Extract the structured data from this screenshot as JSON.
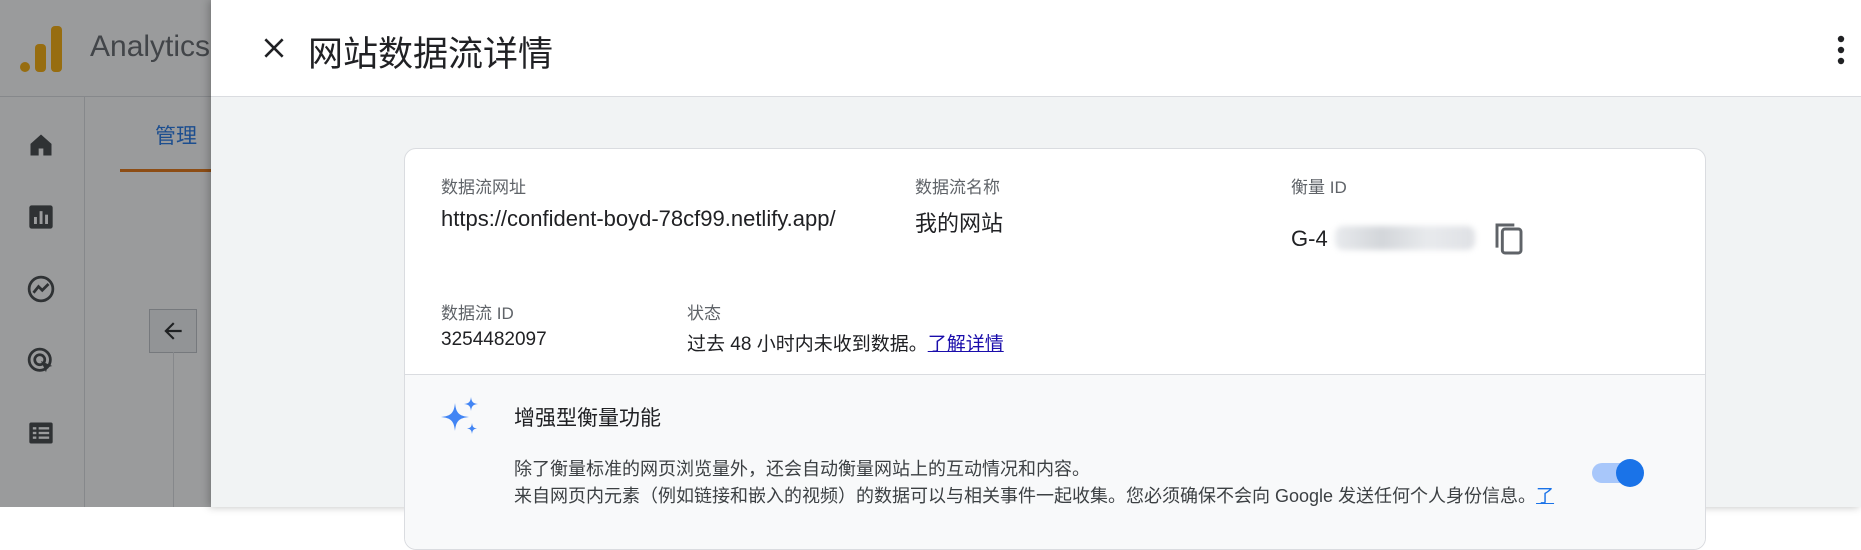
{
  "background_app": {
    "app_title": "Analytics",
    "admin_tab_label": "管理",
    "nav_icons": [
      "home-icon",
      "reports-icon",
      "explore-icon",
      "advertising-icon",
      "list-icon"
    ]
  },
  "drawer": {
    "title": "网站数据流详情",
    "stream_url_label": "数据流网址",
    "stream_url_value": "https://confident-boyd-78cf99.netlify.app/",
    "stream_name_label": "数据流名称",
    "stream_name_value": "我的网站",
    "measurement_id_label": "衡量 ID",
    "measurement_id_value": "G-4",
    "stream_id_label": "数据流 ID",
    "stream_id_value": "3254482097",
    "status_label": "状态",
    "status_value": "过去 48 小时内未收到数据。",
    "status_link": "了解详情",
    "enhanced": {
      "title": "增强型衡量功能",
      "desc_line1": "除了衡量标准的网页浏览量外，还会自动衡量网站上的互动情况和内容。",
      "desc_line2": "来自网页内元素（例如链接和嵌入的视频）的数据可以与相关事件一起收集。您必须确保不会向 Google 发送任何个人身份信息。",
      "desc_link": "了",
      "toggle_on": true
    }
  },
  "colors": {
    "accent_blue": "#1a73e8",
    "admin_underline": "#e8710a",
    "logo_orange": "#f9ab00"
  }
}
